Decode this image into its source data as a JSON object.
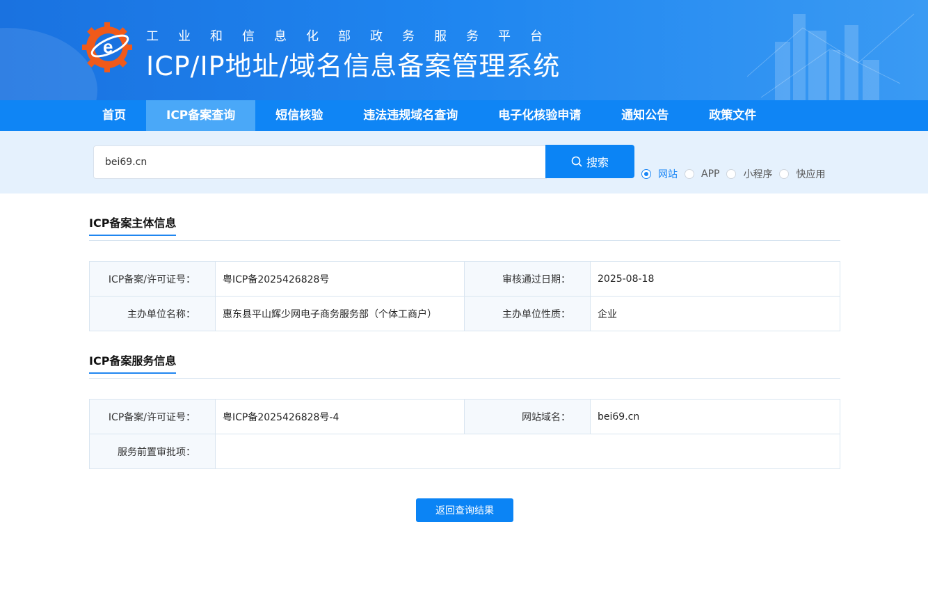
{
  "header": {
    "sub_title": "工业和信息化部政务服务平台",
    "main_title": "ICP/IP地址/域名信息备案管理系统"
  },
  "nav": {
    "items": [
      {
        "label": "首页",
        "active": false
      },
      {
        "label": "ICP备案查询",
        "active": true
      },
      {
        "label": "短信核验",
        "active": false
      },
      {
        "label": "违法违规域名查询",
        "active": false
      },
      {
        "label": "电子化核验申请",
        "active": false
      },
      {
        "label": "通知公告",
        "active": false
      },
      {
        "label": "政策文件",
        "active": false
      }
    ]
  },
  "search": {
    "value": "bei69.cn",
    "button_label": "搜索",
    "types": [
      {
        "label": "网站",
        "checked": true
      },
      {
        "label": "APP",
        "checked": false
      },
      {
        "label": "小程序",
        "checked": false
      },
      {
        "label": "快应用",
        "checked": false
      }
    ]
  },
  "subject_section": {
    "title": "ICP备案主体信息",
    "rows": [
      {
        "label1": "ICP备案/许可证号：",
        "value1": "粤ICP备2025426828号",
        "label2": "审核通过日期：",
        "value2": "2025-08-18"
      },
      {
        "label1": "主办单位名称：",
        "value1": "惠东县平山辉少网电子商务服务部（个体工商户）",
        "label2": "主办单位性质：",
        "value2": "企业"
      }
    ]
  },
  "service_section": {
    "title": "ICP备案服务信息",
    "row1": {
      "label1": "ICP备案/许可证号：",
      "value1": "粤ICP备2025426828号-4",
      "label2": "网站域名：",
      "value2": "bei69.cn"
    },
    "row2": {
      "label": "服务前置审批项：",
      "value": ""
    }
  },
  "back_button_label": "返回查询结果",
  "colors": {
    "primary": "#0b84f5",
    "nav_bg": "#0f85f5",
    "nav_active": "#4aa8f8",
    "search_band": "#e5f1fd"
  }
}
